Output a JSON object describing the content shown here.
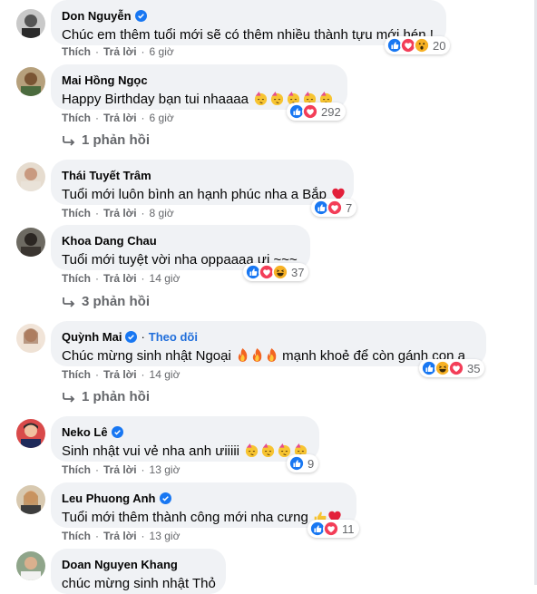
{
  "common": {
    "like_label": "Thích",
    "reply_label": "Trả lời",
    "follow_label": "Theo dõi"
  },
  "comments": [
    {
      "name": "Don Nguyễn",
      "verified": true,
      "text": "Chúc em thêm tuổi mới sẽ có thêm nhiều thành tựu mới hén !",
      "time": "6 giờ",
      "reactions": [
        "like",
        "love",
        "wow"
      ],
      "reaction_count": "20"
    },
    {
      "name": "Mai Hồng Ngọc",
      "verified": false,
      "text": "Happy Birthday bạn tui nhaaaa",
      "emoji": [
        "party-face-emoji",
        "party-face-emoji",
        "party-face-emoji",
        "party-face-emoji",
        "party-face-emoji"
      ],
      "time": "6 giờ",
      "reactions": [
        "like",
        "love"
      ],
      "reaction_count": "292",
      "replies": "1 phản hồi"
    },
    {
      "name": "Thái Tuyết Trâm",
      "verified": false,
      "text": "Tuổi mới luôn bình an hạnh phúc nha a Bắp",
      "emoji": [
        "red-heart-emoji"
      ],
      "time": "8 giờ",
      "reactions": [
        "like",
        "love"
      ],
      "reaction_count": "7"
    },
    {
      "name": "Khoa Dang Chau",
      "verified": false,
      "text": "Tuổi mới tuyệt vời nha oppaaaa ưi ~~~",
      "time": "14 giờ",
      "reactions": [
        "like",
        "love",
        "haha"
      ],
      "reaction_count": "37",
      "replies": "3 phản hồi"
    },
    {
      "name": "Quỳnh Mai",
      "verified": true,
      "follow": true,
      "text_before": "Chúc mừng sinh nhật Ngoại",
      "text_after": "mạnh khoẻ để còn gánh con ạ",
      "emoji": [
        "fire-emoji",
        "fire-emoji",
        "fire-emoji"
      ],
      "time": "14 giờ",
      "reactions": [
        "like",
        "haha",
        "love"
      ],
      "reaction_count": "35",
      "replies": "1 phản hồi"
    },
    {
      "name": "Neko Lê",
      "verified": true,
      "text": "Sinh nhật vui vẻ nha anh ưiiiii",
      "emoji": [
        "party-face-emoji",
        "party-face-emoji",
        "party-face-emoji",
        "party-face-emoji"
      ],
      "time": "13 giờ",
      "reactions": [
        "like"
      ],
      "reaction_count": "9"
    },
    {
      "name": "Leu Phuong Anh",
      "verified": true,
      "text": "Tuổi mới thêm thành công mới nha cưng",
      "emoji": [
        "thumbs-up-emoji",
        "red-heart-emoji"
      ],
      "time": "13 giờ",
      "reactions": [
        "like",
        "love"
      ],
      "reaction_count": "11"
    },
    {
      "name": "Doan Nguyen Khang",
      "verified": false,
      "text": "chúc mừng sinh nhật Thỏ"
    }
  ],
  "colors": {
    "bubble": "#f0f2f5",
    "meta": "#65676b",
    "like": "#1877f2",
    "love": "#f33e58",
    "yellow": "#f7b125",
    "verified": "#1877f2",
    "follow": "#216fdb"
  }
}
